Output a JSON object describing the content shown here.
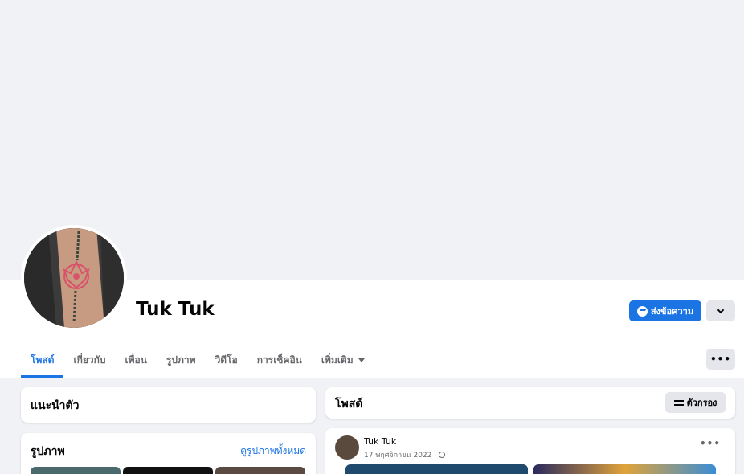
{
  "profile": {
    "name": "Tuk Tuk",
    "message_label": "ส่งข้อความ"
  },
  "tabs": [
    {
      "label": "โพสต์",
      "active": true
    },
    {
      "label": "เกี่ยวกับ"
    },
    {
      "label": "เพื่อน"
    },
    {
      "label": "รูปภาพ"
    },
    {
      "label": "วิดีโอ"
    },
    {
      "label": "การเช็คอิน"
    },
    {
      "label": "เพิ่มเติม"
    }
  ],
  "intro": {
    "title": "แนะนำตัว"
  },
  "photos": {
    "title": "รูปภาพ",
    "see_all": "ดูรูปภาพทั้งหมด"
  },
  "posts": {
    "title": "โพสต์",
    "filter_label": "ตัวกรอง",
    "items": [
      {
        "author": "Tuk Tuk",
        "date": "17 พฤศจิกายน 2022 ·"
      }
    ]
  },
  "colors": {
    "accent": "#1b74e4",
    "background": "#f0f2f5"
  },
  "icons": [
    "messenger-icon",
    "chevron-down-icon",
    "more-icon",
    "filter-icon",
    "globe-icon"
  ]
}
